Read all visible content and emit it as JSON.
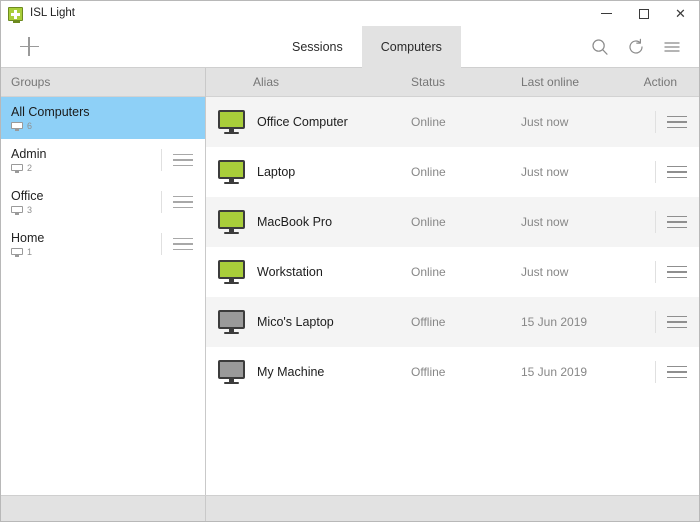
{
  "window": {
    "title": "ISL Light",
    "app_icon": "isl-light-logo-icon",
    "controls": {
      "minimize": "–",
      "maximize": "□",
      "close": "✕"
    }
  },
  "toolbar": {
    "add_icon": "plus-icon",
    "tabs": [
      {
        "label": "Sessions",
        "active": false
      },
      {
        "label": "Computers",
        "active": true
      }
    ],
    "icons": [
      {
        "name": "search-icon"
      },
      {
        "name": "refresh-icon"
      },
      {
        "name": "menu-icon"
      }
    ]
  },
  "sidebar": {
    "header": "Groups",
    "items": [
      {
        "label": "All Computers",
        "count": "6",
        "selected": true
      },
      {
        "label": "Admin",
        "count": "2",
        "selected": false
      },
      {
        "label": "Office",
        "count": "3",
        "selected": false
      },
      {
        "label": "Home",
        "count": "1",
        "selected": false
      }
    ]
  },
  "table": {
    "columns": {
      "alias": "Alias",
      "status": "Status",
      "last_online": "Last online",
      "action": "Action"
    },
    "rows": [
      {
        "alias": "Office Computer",
        "status": "Online",
        "last_online": "Just now",
        "online": true
      },
      {
        "alias": "Laptop",
        "status": "Online",
        "last_online": "Just now",
        "online": true
      },
      {
        "alias": "MacBook Pro",
        "status": "Online",
        "last_online": "Just now",
        "online": true
      },
      {
        "alias": "Workstation",
        "status": "Online",
        "last_online": "Just now",
        "online": true
      },
      {
        "alias": "Mico's Laptop",
        "status": "Offline",
        "last_online": "15 Jun 2019",
        "online": false
      },
      {
        "alias": "My Machine",
        "status": "Offline",
        "last_online": "15 Jun 2019",
        "online": false
      }
    ]
  },
  "statusbar": {
    "text": ""
  },
  "colors": {
    "accent_green": "#a9ce3a",
    "selection_blue": "#8ed0f7",
    "header_gray": "#e2e2e2",
    "row_alt": "#f4f4f4",
    "offline_gray": "#9a9a9a",
    "text_primary": "#1d1d1d",
    "text_muted": "#878787"
  }
}
